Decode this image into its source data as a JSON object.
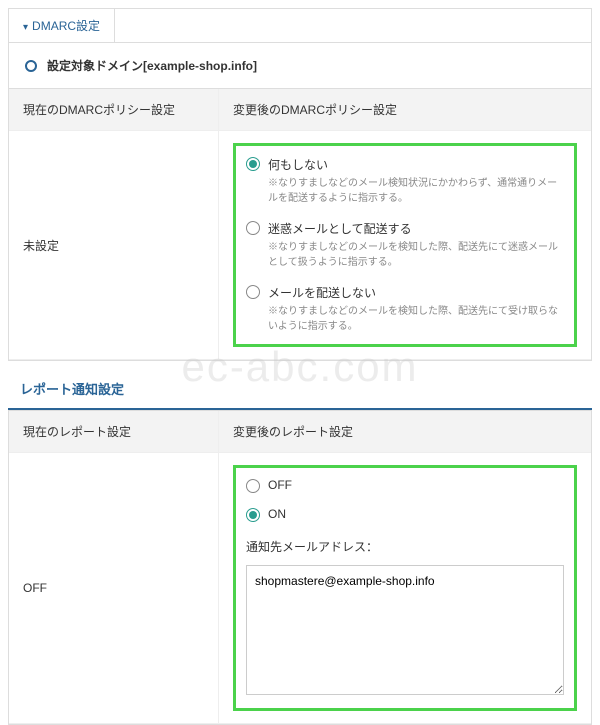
{
  "tab": {
    "label": "DMARC設定"
  },
  "domain": {
    "prefix": "設定対象ドメイン[",
    "name": "example-shop.info",
    "suffix": "]"
  },
  "dmarc": {
    "header_current": "現在のDMARCポリシー設定",
    "header_after": "変更後のDMARCポリシー設定",
    "current_value": "未設定",
    "options": [
      {
        "label": "何もしない",
        "desc": "※なりすましなどのメール検知状況にかかわらず、通常通りメールを配送するように指示する。",
        "checked": true
      },
      {
        "label": "迷惑メールとして配送する",
        "desc": "※なりすましなどのメールを検知した際、配送先にて迷惑メールとして扱うように指示する。",
        "checked": false
      },
      {
        "label": "メールを配送しない",
        "desc": "※なりすましなどのメールを検知した際、配送先にて受け取らないように指示する。",
        "checked": false
      }
    ]
  },
  "report": {
    "section_title": "レポート通知設定",
    "header_current": "現在のレポート設定",
    "header_after": "変更後のレポート設定",
    "current_value": "OFF",
    "options": [
      {
        "label": "OFF",
        "checked": false
      },
      {
        "label": "ON",
        "checked": true
      }
    ],
    "email_field_label": "通知先メールアドレス：",
    "email_value": "shopmastere@example-shop.info"
  },
  "watermark": "ec-abc.com"
}
